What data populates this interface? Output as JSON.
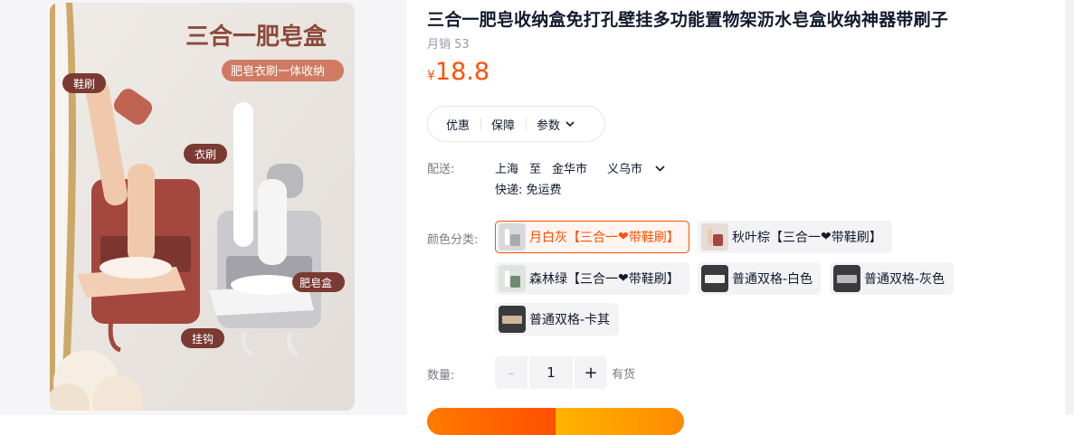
{
  "product": {
    "title": "三合一肥皂收纳盒免打孔壁挂多功能置物架沥水皂盒收纳神器带刷子",
    "sales": "月销 53",
    "currency": "¥",
    "price": "18.8",
    "accent_color": "#ff5000"
  },
  "image": {
    "headline": "三合一肥皂盒",
    "subline": "肥皂衣刷一体收纳",
    "tag_shoe": "鞋刷",
    "tag_clothes": "衣刷",
    "tag_soap": "肥皂盒",
    "tag_hook": "挂钩"
  },
  "tabs": [
    {
      "label": "优惠"
    },
    {
      "label": "保障"
    },
    {
      "label": "参数",
      "icon": "chevron-down-icon"
    }
  ],
  "shipping": {
    "label": "配送:",
    "from": "上海",
    "to_word": "至",
    "city": "金华市",
    "district": "义乌市",
    "express": "快递: 免运费"
  },
  "sku": {
    "label": "颜色分类:",
    "options": [
      {
        "text": "月白灰【三合一",
        "heart": "❤",
        "suffix": "带鞋刷】",
        "selected": true
      },
      {
        "text": "秋叶棕【三合一",
        "heart": "❤",
        "suffix": "带鞋刷】",
        "selected": false
      },
      {
        "text": "森林绿【三合一",
        "heart": "❤",
        "suffix": "带鞋刷】",
        "selected": false
      },
      {
        "text": "普通双格-白色",
        "selected": false
      },
      {
        "text": "普通双格-灰色",
        "selected": false
      },
      {
        "text": "普通双格-卡其",
        "selected": false
      }
    ]
  },
  "quantity": {
    "label": "数量:",
    "minus": "-",
    "value": "1",
    "plus": "+",
    "stock": "有货"
  }
}
